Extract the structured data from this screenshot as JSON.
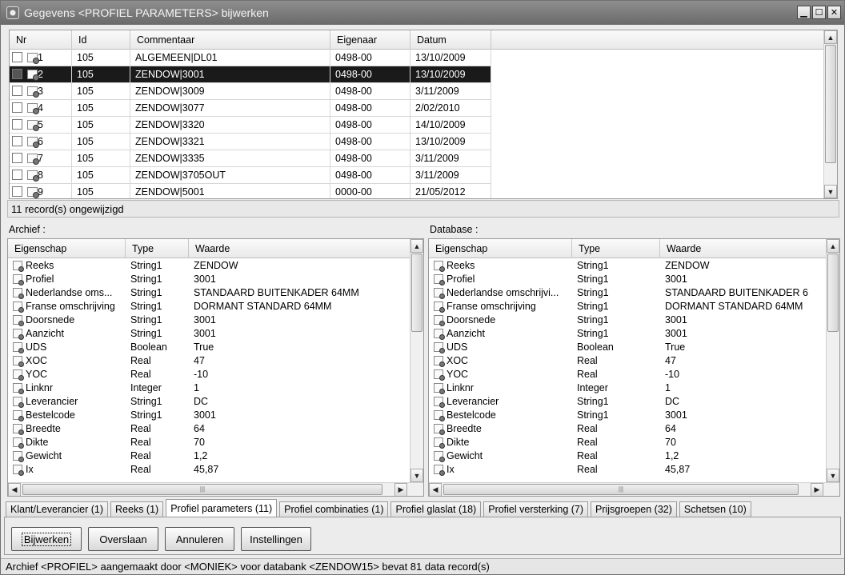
{
  "window": {
    "title": "Gegevens <PROFIEL PARAMETERS> bijwerken"
  },
  "records": {
    "columns": [
      "Nr",
      "Id",
      "Commentaar",
      "Eigenaar",
      "Datum"
    ],
    "rows": [
      {
        "nr": "1",
        "id": "105",
        "commentaar": "ALGEMEEN|DL01",
        "eigenaar": "0498-00",
        "datum": "13/10/2009",
        "selected": false
      },
      {
        "nr": "2",
        "id": "105",
        "commentaar": "ZENDOW|3001",
        "eigenaar": "0498-00",
        "datum": "13/10/2009",
        "selected": true
      },
      {
        "nr": "3",
        "id": "105",
        "commentaar": "ZENDOW|3009",
        "eigenaar": "0498-00",
        "datum": "3/11/2009",
        "selected": false
      },
      {
        "nr": "4",
        "id": "105",
        "commentaar": "ZENDOW|3077",
        "eigenaar": "0498-00",
        "datum": "2/02/2010",
        "selected": false
      },
      {
        "nr": "5",
        "id": "105",
        "commentaar": "ZENDOW|3320",
        "eigenaar": "0498-00",
        "datum": "14/10/2009",
        "selected": false
      },
      {
        "nr": "6",
        "id": "105",
        "commentaar": "ZENDOW|3321",
        "eigenaar": "0498-00",
        "datum": "13/10/2009",
        "selected": false
      },
      {
        "nr": "7",
        "id": "105",
        "commentaar": "ZENDOW|3335",
        "eigenaar": "0498-00",
        "datum": "3/11/2009",
        "selected": false
      },
      {
        "nr": "8",
        "id": "105",
        "commentaar": "ZENDOW|3705OUT",
        "eigenaar": "0498-00",
        "datum": "3/11/2009",
        "selected": false
      },
      {
        "nr": "9",
        "id": "105",
        "commentaar": "ZENDOW|5001",
        "eigenaar": "0000-00",
        "datum": "21/05/2012",
        "selected": false
      }
    ],
    "status": "11 record(s) ongewijzigd"
  },
  "archief": {
    "label": "Archief :",
    "columns": [
      "Eigenschap",
      "Type",
      "Waarde"
    ],
    "rows": [
      [
        "Reeks",
        "String1",
        "ZENDOW"
      ],
      [
        "Profiel",
        "String1",
        "3001"
      ],
      [
        "Nederlandse oms...",
        "String1",
        "STANDAARD BUITENKADER 64MM"
      ],
      [
        "Franse omschrijving",
        "String1",
        "DORMANT STANDARD 64MM"
      ],
      [
        "Doorsnede",
        "String1",
        "3001"
      ],
      [
        "Aanzicht",
        "String1",
        "3001"
      ],
      [
        "UDS",
        "Boolean",
        "True"
      ],
      [
        "XOC",
        "Real",
        "47"
      ],
      [
        "YOC",
        "Real",
        "-10"
      ],
      [
        "Linknr",
        "Integer",
        "1"
      ],
      [
        "Leverancier",
        "String1",
        "DC"
      ],
      [
        "Bestelcode",
        "String1",
        "3001"
      ],
      [
        "Breedte",
        "Real",
        "64"
      ],
      [
        "Dikte",
        "Real",
        "70"
      ],
      [
        "Gewicht",
        "Real",
        "1,2"
      ],
      [
        "Ix",
        "Real",
        "45,87"
      ]
    ]
  },
  "database": {
    "label": "Database :",
    "columns": [
      "Eigenschap",
      "Type",
      "Waarde"
    ],
    "rows": [
      [
        "Reeks",
        "String1",
        "ZENDOW"
      ],
      [
        "Profiel",
        "String1",
        "3001"
      ],
      [
        "Nederlandse omschrijvi...",
        "String1",
        "STANDAARD BUITENKADER 6"
      ],
      [
        "Franse omschrijving",
        "String1",
        "DORMANT STANDARD 64MM"
      ],
      [
        "Doorsnede",
        "String1",
        "3001"
      ],
      [
        "Aanzicht",
        "String1",
        "3001"
      ],
      [
        "UDS",
        "Boolean",
        "True"
      ],
      [
        "XOC",
        "Real",
        "47"
      ],
      [
        "YOC",
        "Real",
        "-10"
      ],
      [
        "Linknr",
        "Integer",
        "1"
      ],
      [
        "Leverancier",
        "String1",
        "DC"
      ],
      [
        "Bestelcode",
        "String1",
        "3001"
      ],
      [
        "Breedte",
        "Real",
        "64"
      ],
      [
        "Dikte",
        "Real",
        "70"
      ],
      [
        "Gewicht",
        "Real",
        "1,2"
      ],
      [
        "Ix",
        "Real",
        "45,87"
      ]
    ]
  },
  "tabs": [
    {
      "label": "Klant/Leverancier (1)",
      "active": false
    },
    {
      "label": "Reeks (1)",
      "active": false
    },
    {
      "label": "Profiel parameters (11)",
      "active": true
    },
    {
      "label": "Profiel combinaties (1)",
      "active": false
    },
    {
      "label": "Profiel glaslat (18)",
      "active": false
    },
    {
      "label": "Profiel versterking (7)",
      "active": false
    },
    {
      "label": "Prijsgroepen (32)",
      "active": false
    },
    {
      "label": "Schetsen (10)",
      "active": false
    }
  ],
  "buttons": {
    "bijwerken": "Bijwerken",
    "overslaan": "Overslaan",
    "annuleren": "Annuleren",
    "instellingen": "Instellingen"
  },
  "statusbar": "Archief <PROFIEL> aangemaakt door <MONIEK> voor databank <ZENDOW15> bevat 81 data record(s)",
  "icons": {
    "app": "app-icon",
    "record": "record-icon",
    "property": "property-icon"
  }
}
